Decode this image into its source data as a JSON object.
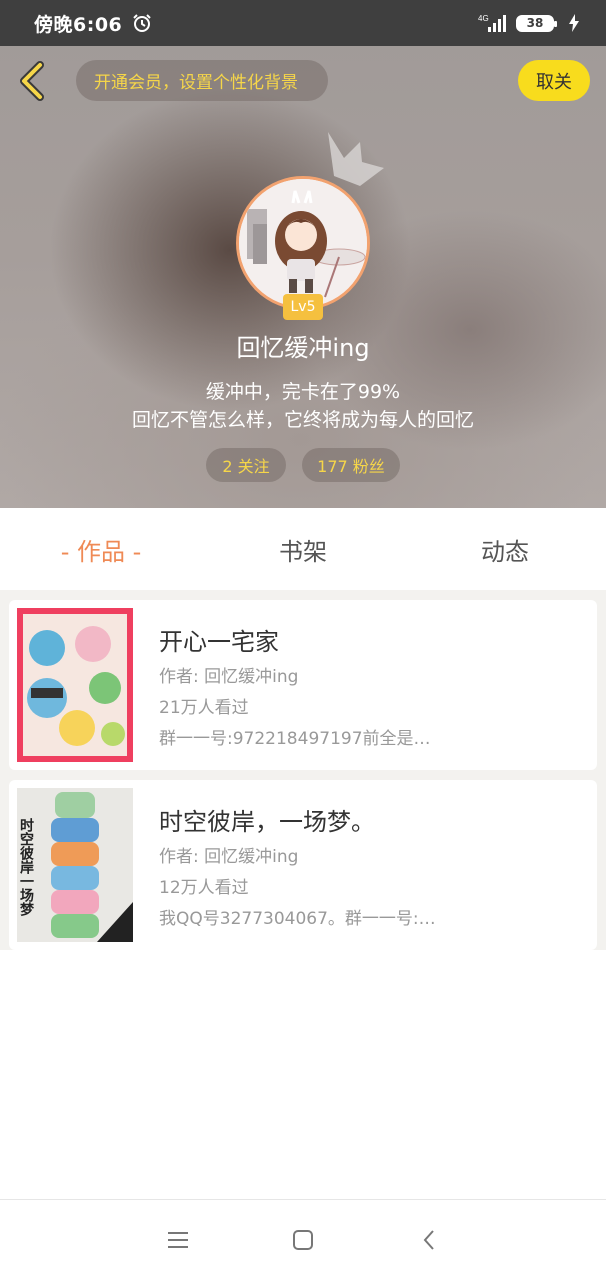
{
  "status_bar": {
    "time": "傍晚6:06",
    "battery": "38",
    "network": "4G"
  },
  "header": {
    "vip_prompt": "开通会员，设置个性化背景",
    "follow_button": "取关"
  },
  "profile": {
    "level": "Lv5",
    "username": "回忆缓冲ing",
    "bio_line1": "缓冲中，完卡在了99%",
    "bio_line2": "回忆不管怎么样，它终将成为每人的回忆",
    "following": "2 关注",
    "followers": "177 粉丝"
  },
  "tabs": [
    {
      "label": "- 作品 -",
      "active": true
    },
    {
      "label": "书架",
      "active": false
    },
    {
      "label": "动态",
      "active": false
    }
  ],
  "works": [
    {
      "title": "开心一宅家",
      "author": "作者: 回忆缓冲ing",
      "views": "21万人看过",
      "desc": "群一一号:972218497197前全是…"
    },
    {
      "title": "时空彼岸，一场梦。",
      "author": "作者: 回忆缓冲ing",
      "views": "12万人看过",
      "desc": "我QQ号3277304067。群一一号:…",
      "cover_text": "时空彼岸一场梦"
    }
  ],
  "colors": {
    "accent": "#ef8a55",
    "vip_text": "#f6d649",
    "follow_button_bg": "#f8dc1d"
  }
}
